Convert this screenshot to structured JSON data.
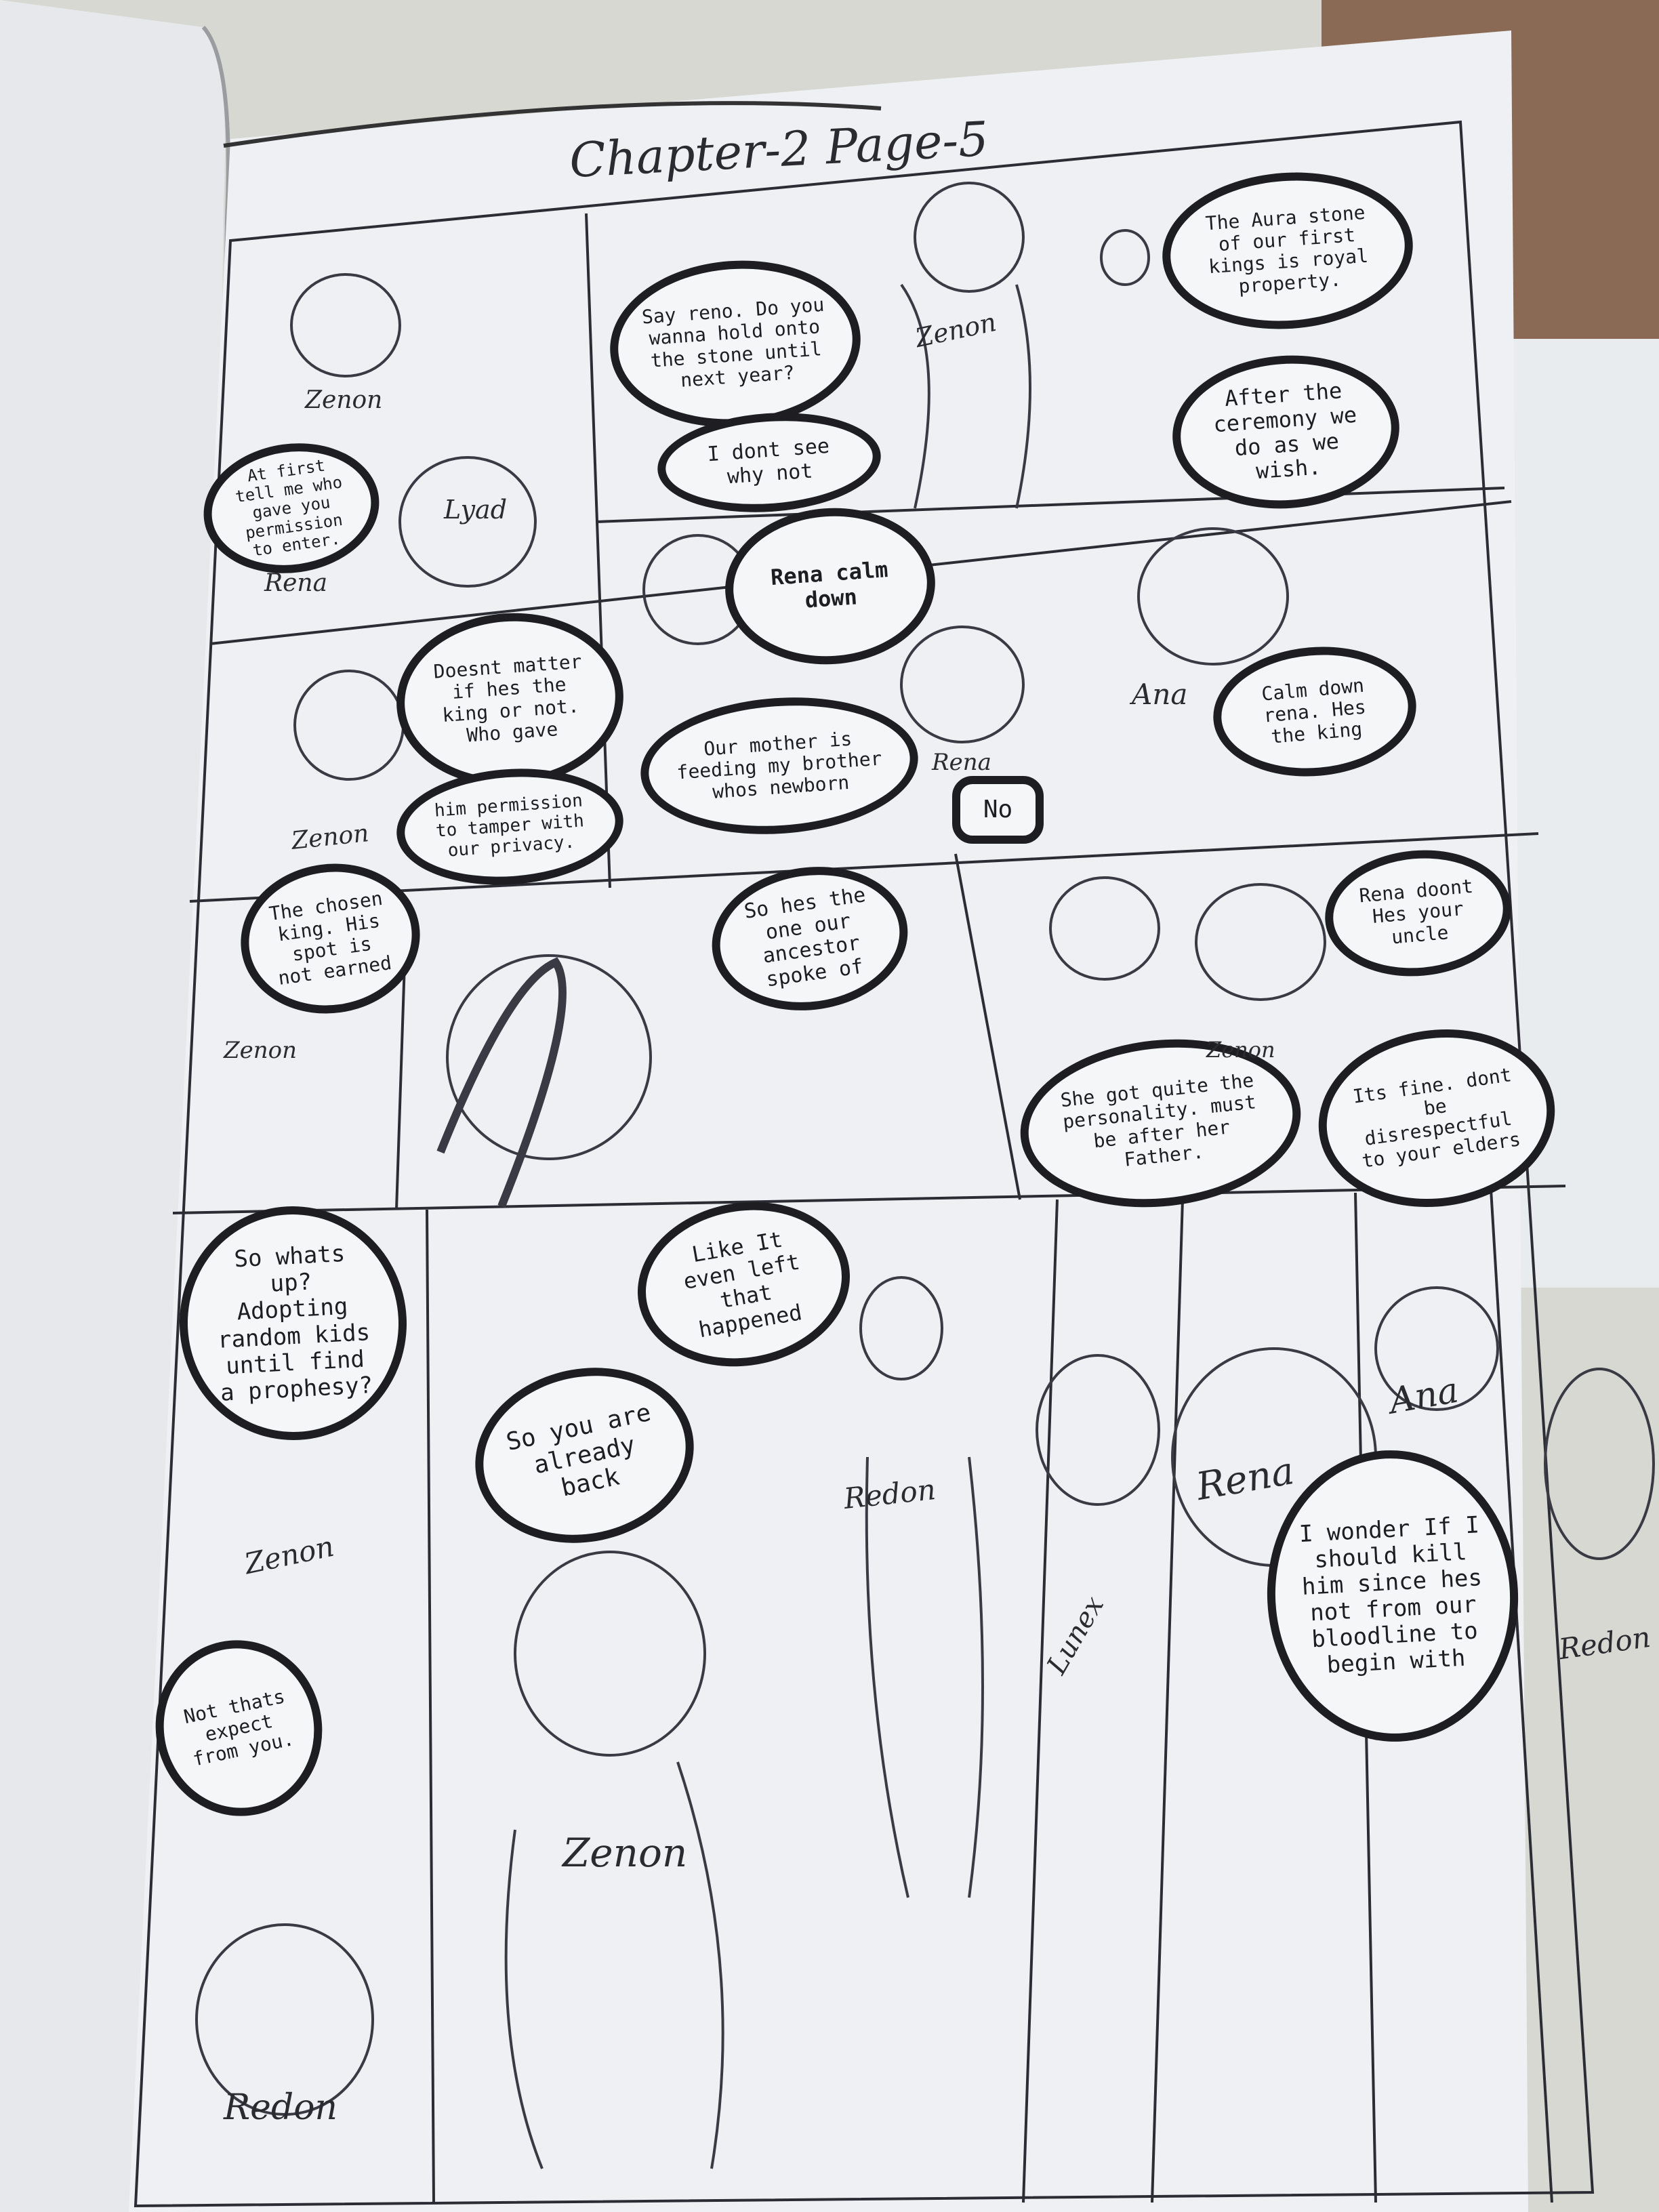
{
  "title": "Chapter-2  Page-5",
  "bubbles": [
    {
      "text": "At first tell me who gave you permission to enter."
    },
    {
      "text": "Say reno. Do you wanna hold onto the stone until next year?"
    },
    {
      "text": "I dont see why not"
    },
    {
      "text": "The Aura stone of our first kings is royal property."
    },
    {
      "text": "After the ceremony we do as we wish."
    },
    {
      "text": "Doesnt matter if hes the king or not. Who gave"
    },
    {
      "text": "him permission to tamper with our privacy."
    },
    {
      "text": "Rena calm down"
    },
    {
      "text": "Our mother is feeding my brother whos newborn"
    },
    {
      "text": "No"
    },
    {
      "text": "Calm down rena. Hes the king"
    },
    {
      "text": "The chosen king. His spot is not earned"
    },
    {
      "text": "So hes the one our ancestor spoke of"
    },
    {
      "text": "Rena doont Hes your uncle"
    },
    {
      "text": "She got quite the personality. must be after her Father."
    },
    {
      "text": "Its fine. dont be disrespectful to your elders"
    },
    {
      "text": "So whats up? Adopting random kids until find a prophesy?"
    },
    {
      "text": "Like It even left that happened"
    },
    {
      "text": "So you are already back"
    },
    {
      "text": "Not thats expect from you."
    },
    {
      "text": "I wonder If I should kill him since hes not from our bloodline to begin with"
    }
  ],
  "names": [
    "Zenon",
    "Lyad",
    "Rena",
    "Zenon",
    "Ana",
    "Rena",
    "Zenon",
    "Zenon",
    "Zenon",
    "Redon",
    "Zenon",
    "Zenon",
    "Redon",
    "Rena",
    "Lunex",
    "Ana",
    "Redon"
  ]
}
